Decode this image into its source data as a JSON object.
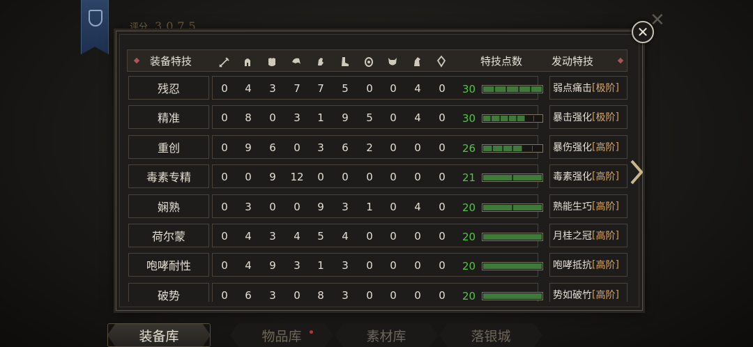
{
  "top": {
    "score_label": "评分",
    "score_value": "3075"
  },
  "table": {
    "header": {
      "name_col": "装备特技",
      "points_col": "特技点数",
      "skill_col": "发动特技",
      "slot_icons": [
        "sword-icon",
        "helmet-icon",
        "chest-armor-icon",
        "pauldron-icon",
        "gauntlet-icon",
        "boots-icon",
        "amulet-icon",
        "demon-mask-icon",
        "horse-icon",
        "gem-icon"
      ]
    },
    "rows": [
      {
        "name": "残忍",
        "vals": [
          "0",
          "4",
          "3",
          "7",
          "7",
          "5",
          "0",
          "0",
          "4",
          "0"
        ],
        "points": "30",
        "filled": 5,
        "segs": 5,
        "skill": "弱点痛击",
        "tier": "极阶"
      },
      {
        "name": "精准",
        "vals": [
          "0",
          "8",
          "0",
          "3",
          "1",
          "9",
          "5",
          "0",
          "4",
          "0"
        ],
        "points": "30",
        "filled": 5,
        "segs": 7,
        "skill": "暴击强化",
        "tier": "极阶"
      },
      {
        "name": "重创",
        "vals": [
          "0",
          "9",
          "6",
          "0",
          "3",
          "6",
          "2",
          "0",
          "0",
          "0"
        ],
        "points": "26",
        "filled": 4,
        "segs": 6,
        "skill": "暴伤强化",
        "tier": "高阶"
      },
      {
        "name": "毒素专精",
        "vals": [
          "0",
          "0",
          "9",
          "12",
          "0",
          "0",
          "0",
          "0",
          "0",
          "0"
        ],
        "points": "21",
        "filled": 2,
        "segs": 2,
        "skill": "毒素强化",
        "tier": "高阶"
      },
      {
        "name": "娴熟",
        "vals": [
          "0",
          "3",
          "0",
          "0",
          "9",
          "3",
          "1",
          "0",
          "4",
          "0"
        ],
        "points": "20",
        "filled": 2,
        "segs": 2,
        "skill": "熟能生巧",
        "tier": "高阶"
      },
      {
        "name": "荷尔蒙",
        "vals": [
          "0",
          "4",
          "3",
          "4",
          "5",
          "4",
          "0",
          "0",
          "0",
          "0"
        ],
        "points": "20",
        "filled": 1,
        "segs": 1,
        "skill": "月桂之冠",
        "tier": "高阶"
      },
      {
        "name": "咆哮耐性",
        "vals": [
          "0",
          "4",
          "9",
          "3",
          "1",
          "3",
          "0",
          "0",
          "0",
          "0"
        ],
        "points": "20",
        "filled": 1,
        "segs": 1,
        "skill": "咆哮抵抗",
        "tier": "高阶"
      },
      {
        "name": "破势",
        "vals": [
          "0",
          "6",
          "3",
          "0",
          "8",
          "3",
          "0",
          "0",
          "0",
          "0"
        ],
        "points": "20",
        "filled": 1,
        "segs": 1,
        "skill": "势如破竹",
        "tier": "高阶"
      }
    ]
  },
  "tabs": [
    {
      "label": "装备库",
      "active": true
    },
    {
      "label": "物品库",
      "active": false
    },
    {
      "label": "素材库",
      "active": false
    },
    {
      "label": "落银城",
      "active": false
    }
  ],
  "colors": {
    "points_green": "#57c24a",
    "bar_fill": "#3f7a3a",
    "tier_orange": "#d8a86a"
  }
}
